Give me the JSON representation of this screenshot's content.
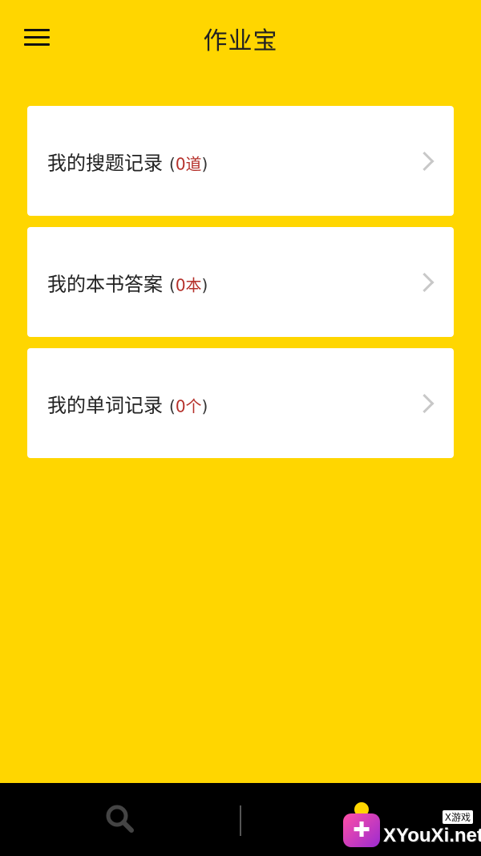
{
  "header": {
    "title": "作业宝",
    "menu_icon": "hamburger-menu-icon"
  },
  "records": [
    {
      "label": "我的搜题记录",
      "count": "0道"
    },
    {
      "label": "我的本书答案",
      "count": "0本"
    },
    {
      "label": "我的单词记录",
      "count": "0个"
    }
  ],
  "bottom_nav": {
    "search_icon": "search-icon",
    "home_icon": "home-icon"
  },
  "watermark": {
    "logo": "✚",
    "text": "XYouXi.net",
    "cn_text": "X游戏"
  },
  "colors": {
    "background": "#FFD600",
    "count_accent": "#B5302A",
    "bottom_bar": "#000000"
  }
}
